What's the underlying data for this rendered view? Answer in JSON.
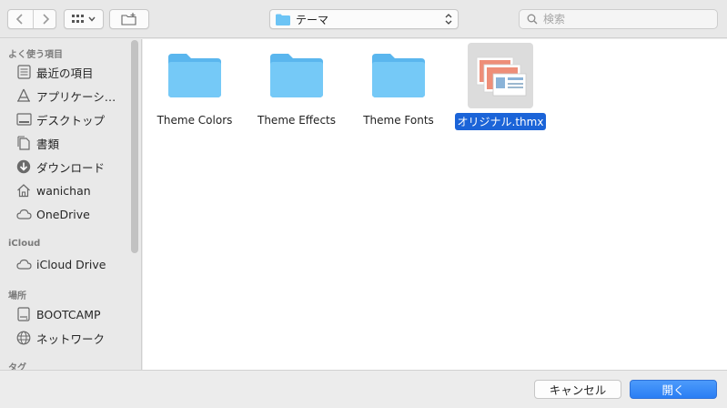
{
  "toolbar": {
    "location_label": "テーマ",
    "search_placeholder": "検索"
  },
  "sidebar": {
    "sections": [
      {
        "title": "よく使う項目"
      },
      {
        "title": "iCloud"
      },
      {
        "title": "場所"
      },
      {
        "title": "タグ"
      }
    ],
    "favorites": [
      {
        "label": "最近の項目",
        "icon": "recents-icon"
      },
      {
        "label": "アプリケーシ…",
        "icon": "applications-icon"
      },
      {
        "label": "デスクトップ",
        "icon": "desktop-icon"
      },
      {
        "label": "書類",
        "icon": "documents-icon"
      },
      {
        "label": "ダウンロード",
        "icon": "downloads-icon"
      },
      {
        "label": "wanichan",
        "icon": "home-icon"
      },
      {
        "label": "OneDrive",
        "icon": "cloud-icon"
      }
    ],
    "icloud": [
      {
        "label": "iCloud Drive",
        "icon": "cloud-icon"
      }
    ],
    "locations": [
      {
        "label": "BOOTCAMP",
        "icon": "disk-icon"
      },
      {
        "label": "ネットワーク",
        "icon": "network-icon"
      }
    ]
  },
  "files": [
    {
      "name": "Theme Colors",
      "kind": "folder",
      "selected": false
    },
    {
      "name": "Theme Effects",
      "kind": "folder",
      "selected": false
    },
    {
      "name": "Theme Fonts",
      "kind": "folder",
      "selected": false
    },
    {
      "name": "オリジナル.thmx",
      "kind": "thmx-file",
      "selected": true
    }
  ],
  "footer": {
    "cancel_label": "キャンセル",
    "open_label": "開く"
  },
  "colors": {
    "folder": "#6cc4f5",
    "selection": "#1b64d8",
    "accent": "#2a7ef4"
  }
}
